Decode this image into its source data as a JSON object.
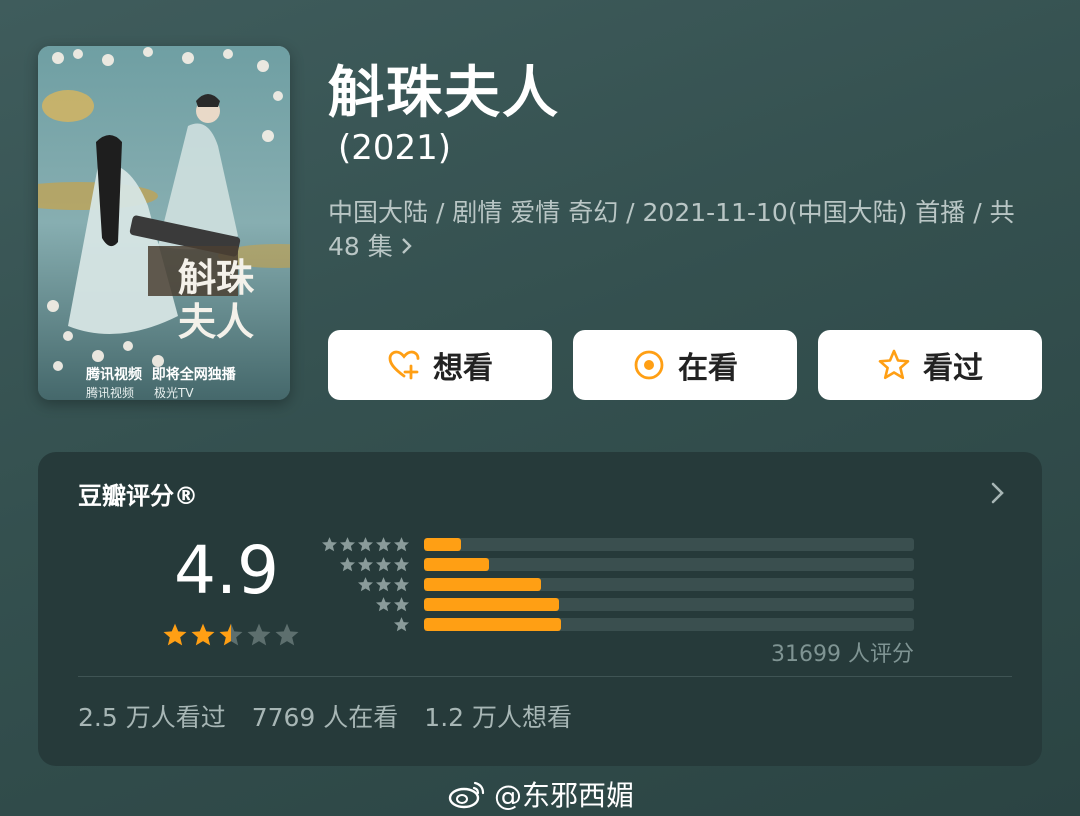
{
  "movie": {
    "title": "斛珠夫人",
    "year": "(2021)",
    "meta": "中国大陆 / 剧情 爱情 奇幻 / 2021-11-10(中国大陆) 首播 / 共 48 集",
    "poster": {
      "title_calligraphy": "斛珠夫人",
      "platform": "腾讯视频  即将全网独播",
      "logos": [
        "腾讯视频",
        "极光TV"
      ]
    }
  },
  "actions": {
    "want": "想看",
    "watching": "在看",
    "watched": "看过"
  },
  "rating": {
    "label": "豆瓣评分®",
    "score": "4.9",
    "stars": 2.5,
    "distribution": [
      {
        "stars": 5,
        "percent": 7.5
      },
      {
        "stars": 4,
        "percent": 13.2
      },
      {
        "stars": 3,
        "percent": 23.8
      },
      {
        "stars": 2,
        "percent": 27.6
      },
      {
        "stars": 1,
        "percent": 28
      }
    ],
    "count": "31699 人评分",
    "stats": [
      "2.5 万人看过",
      "7769 人在看",
      "1.2 万人想看"
    ]
  },
  "watermark": "@东邪西媚",
  "colors": {
    "accent": "#ff9f14",
    "background": "#3a5555",
    "panel": "#263a3a",
    "button_bg": "#ffffff"
  }
}
